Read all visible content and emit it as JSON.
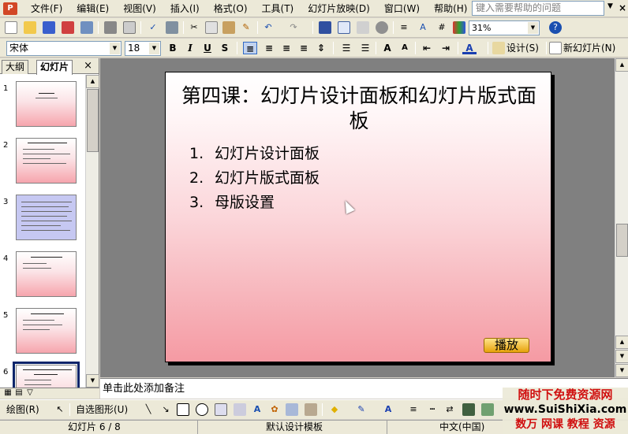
{
  "menubar": {
    "items": [
      "文件(F)",
      "编辑(E)",
      "视图(V)",
      "插入(I)",
      "格式(O)",
      "工具(T)",
      "幻灯片放映(D)",
      "窗口(W)",
      "帮助(H)"
    ],
    "help_placeholder": "键入需要帮助的问题"
  },
  "toolbar": {
    "zoom": "31%"
  },
  "format_toolbar": {
    "font_name": "宋体",
    "font_size": "18",
    "design_label": "设计(S)",
    "new_slide_label": "新幻灯片(N)"
  },
  "left_pane": {
    "tabs": [
      "大纲",
      "幻灯片"
    ],
    "active_tab": "幻灯片",
    "slide_numbers": [
      "1",
      "2",
      "3",
      "4",
      "5",
      "6"
    ]
  },
  "slide": {
    "title": "第四课：幻灯片设计面板和幻灯片版式面板",
    "items": [
      {
        "num": "1.",
        "text": "幻灯片设计面板"
      },
      {
        "num": "2.",
        "text": "幻灯片版式面板"
      },
      {
        "num": "3.",
        "text": "母版设置"
      }
    ],
    "play_button": "播放"
  },
  "notes_placeholder": "单击此处添加备注",
  "drawing_toolbar": {
    "draw_label": "绘图(R)",
    "autoshapes_label": "自选图形(U)"
  },
  "status": {
    "slide_info": "幻灯片 6 / 8",
    "template": "默认设计模板",
    "language": "中文(中国)"
  },
  "watermark": {
    "line1": "随时下免费资源网",
    "line2": "www.SuiShiXia.com",
    "line3": "数万 网课 教程 资源"
  },
  "colors": {
    "slide_gradient_bottom": "#f59aa3",
    "play_button": "#e7a20a",
    "selection": "#0a246a"
  }
}
